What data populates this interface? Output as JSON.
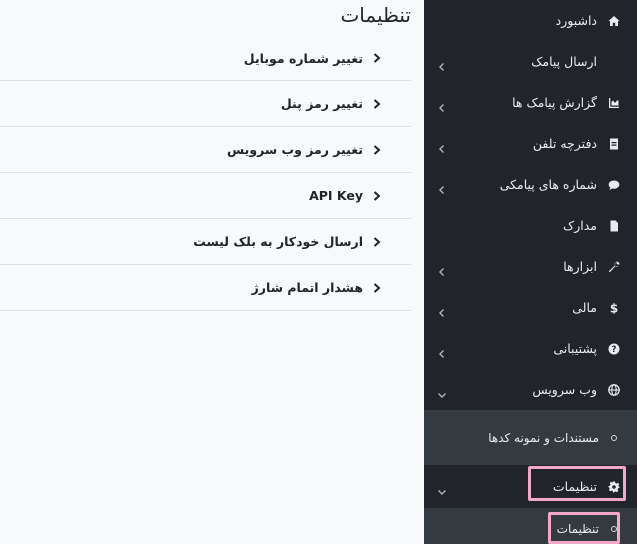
{
  "main": {
    "title": "تنظیمات",
    "settings": [
      {
        "label": "تغییر شماره موبایل"
      },
      {
        "label": "تغییر رمز پنل"
      },
      {
        "label": "تغییر رمز وب سرویس"
      },
      {
        "label": "API Key"
      },
      {
        "label": "ارسال خودکار به بلک لیست"
      },
      {
        "label": "هشدار اتمام شارژ"
      }
    ]
  },
  "sidebar": {
    "items": [
      {
        "label": "داشبورد",
        "icon": "home-icon"
      },
      {
        "label": "ارسال پیامک",
        "icon": "send-icon"
      },
      {
        "label": "گزارش پیامک ها",
        "icon": "chart-icon"
      },
      {
        "label": "دفترچه تلفن",
        "icon": "address-book-icon"
      },
      {
        "label": "شماره های پیامکی",
        "icon": "chat-icon"
      },
      {
        "label": "مدارک",
        "icon": "file-icon"
      },
      {
        "label": "ابزارها",
        "icon": "wrench-icon"
      },
      {
        "label": "مالی",
        "icon": "dollar-icon"
      },
      {
        "label": "پشتیبانی",
        "icon": "question-icon"
      },
      {
        "label": "وب سرویس",
        "icon": "globe-icon"
      }
    ],
    "webservice_sub": {
      "label": "مستندات و نمونه کدها"
    },
    "settings_item": {
      "label": "تنظیمات",
      "icon": "gear-icon"
    },
    "settings_sub": {
      "label": "تنظیمات"
    }
  },
  "colors": {
    "sidebar_bg": "#212529",
    "submenu_bg": "#343a40",
    "highlight": "#f4a7c7",
    "main_bg": "#f8f9fb"
  }
}
